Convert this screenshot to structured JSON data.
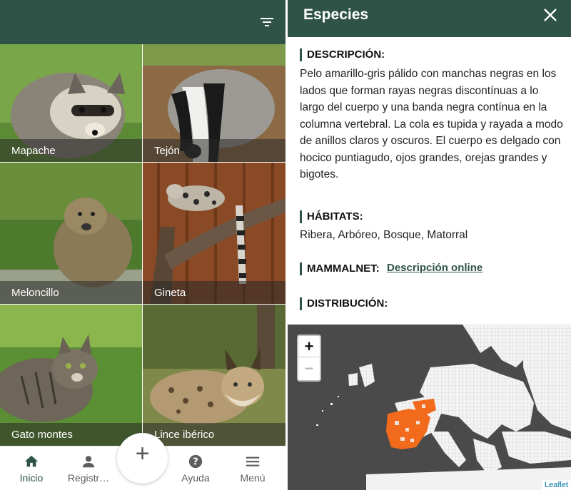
{
  "species_list": {
    "tiles": [
      {
        "label": "Mapache"
      },
      {
        "label": "Tejón"
      },
      {
        "label": "Meloncillo"
      },
      {
        "label": "Gineta"
      },
      {
        "label": "Gato montes"
      },
      {
        "label": "Lince ibérico"
      }
    ]
  },
  "bottom_nav": {
    "items": [
      {
        "label": "Inicio",
        "icon": "home-icon"
      },
      {
        "label": "Registr…",
        "icon": "person-icon"
      },
      {
        "label": "Ayuda",
        "icon": "help-icon"
      },
      {
        "label": "Menú",
        "icon": "menu-icon"
      }
    ],
    "fab_icon": "+"
  },
  "detail": {
    "title": "Especies",
    "descripcion_heading": "DESCRIPCIÓN:",
    "descripcion_text": "Pelo amarillo-gris pálido con manchas negras en los lados que forman rayas negras discontínuas a lo largo del cuerpo y una banda negra contínua en la columna vertebral. La cola es tupida y rayada a modo de anillos claros y oscuros. El cuerpo es delgado con hocico puntiagudo, ojos grandes, orejas grandes y bigotes.",
    "habitats_heading": "HÁBITATS:",
    "habitats_text": "Ribera, Arbóreo, Bosque, Matorral",
    "mammalnet_heading": "MAMMALNET:",
    "mammalnet_link": "Descripción online",
    "distribucion_heading": "DISTRIBUCIÓN:"
  },
  "map": {
    "zoom_in": "+",
    "zoom_out": "−",
    "attribution": "Leaflet"
  },
  "colors": {
    "primary": "#2f5447",
    "distribution": "#f26a1b"
  }
}
